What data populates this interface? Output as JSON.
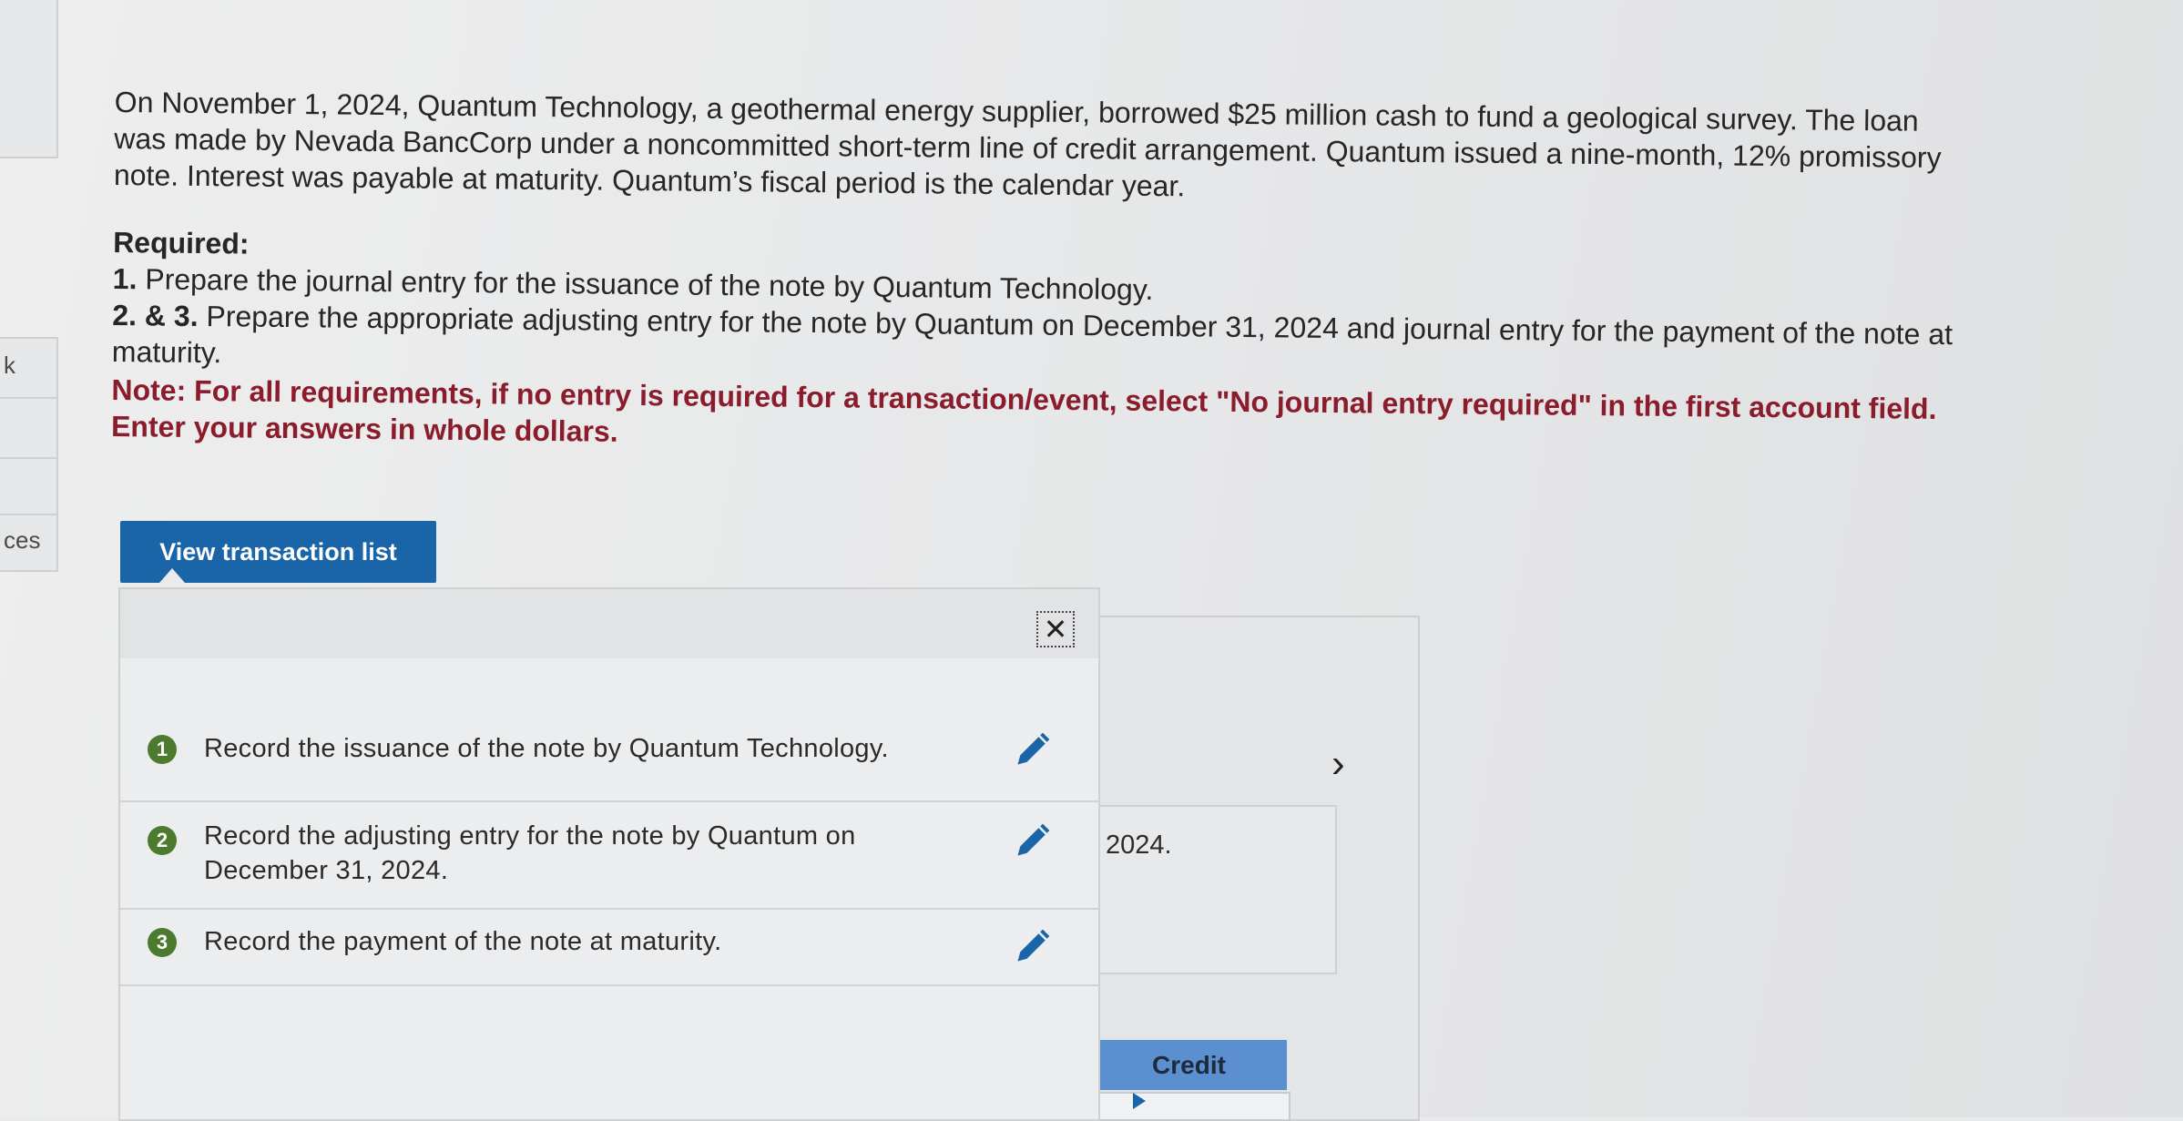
{
  "sidebar": {
    "label_top": "k",
    "label_bottom": "ces"
  },
  "problem": {
    "paragraph": "On November 1, 2024, Quantum Technology, a geothermal energy supplier, borrowed $25 million cash to fund a geological survey. The loan was made by Nevada BancCorp under a noncommitted short-term line of credit arrangement. Quantum issued a nine-month, 12% promissory note. Interest was payable at maturity. Quantum’s fiscal period is the calendar year.",
    "required_title": "Required:",
    "req1_num": "1.",
    "req1_text": " Prepare the journal entry for the issuance of the note by Quantum Technology.",
    "req2_num": "2. & 3.",
    "req2_text": " Prepare the appropriate adjusting entry for the note by Quantum on December 31, 2024 and journal entry for the payment of the note at maturity.",
    "note": "Note: For all requirements, if no entry is required for a transaction/event, select \"No journal entry required\" in the first account field. Enter your answers in whole dollars."
  },
  "view_transaction_button": "View transaction list",
  "popup": {
    "close_symbol": "✕",
    "tasks": [
      {
        "number": "1",
        "text": "Record the issuance of the note by Quantum Technology."
      },
      {
        "number": "2",
        "text": "Record the adjusting entry for the note by Quantum on December 31, 2024."
      },
      {
        "number": "3",
        "text": "Record the payment of the note at maturity."
      }
    ],
    "edit_icon": "pencil-icon",
    "badge_color": "#4c7a2e"
  },
  "background": {
    "chevron": "›",
    "year_text": "2024.",
    "credit_header": "Credit"
  },
  "colors": {
    "button_blue": "#1a64a8",
    "note_red": "#8b1c2c",
    "credit_header_blue": "#5b8fd0"
  }
}
